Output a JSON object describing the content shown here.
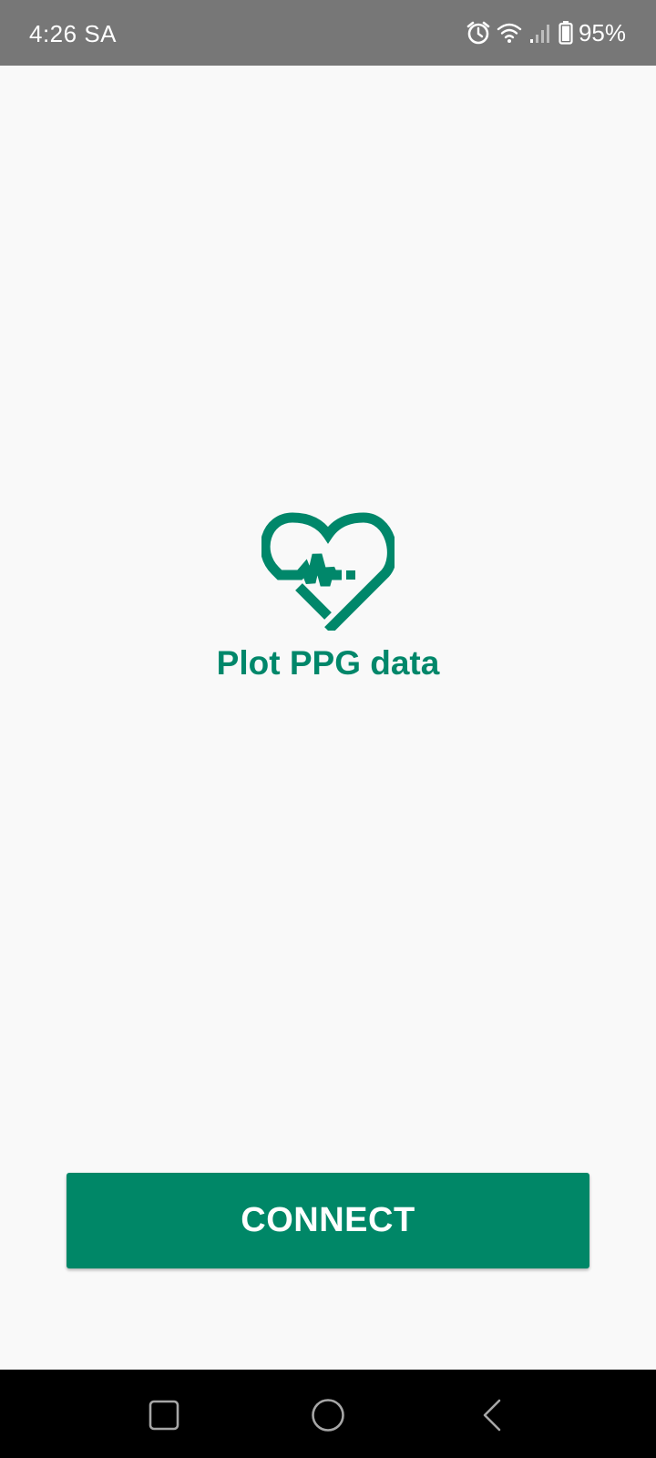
{
  "status_bar": {
    "time": "4:26 SA",
    "battery_percent": "95%",
    "icons": [
      "alarm-icon",
      "wifi-icon",
      "signal-icon",
      "battery-icon"
    ]
  },
  "main": {
    "logo_icon": "heart-pulse-icon",
    "title": "Plot PPG data",
    "connect_label": "CONNECT"
  },
  "nav_bar": {
    "icons": [
      "recents-icon",
      "home-icon",
      "back-icon"
    ]
  },
  "colors": {
    "accent": "#00876a",
    "button": "#008767",
    "status_bar": "#777777",
    "background": "#f9f9f9",
    "nav_bar": "#000000"
  }
}
